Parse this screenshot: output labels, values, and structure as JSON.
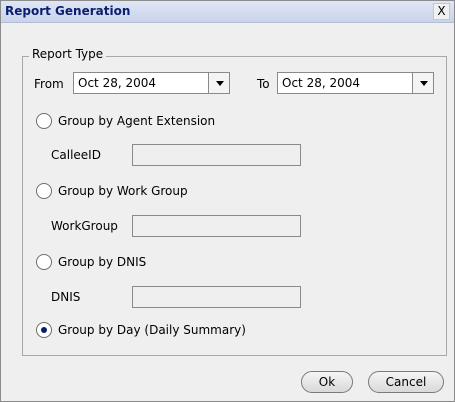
{
  "window": {
    "title": "Report Generation",
    "close_glyph": "X"
  },
  "report_type": {
    "legend": "Report Type",
    "from_label": "From",
    "from_value": "Oct 28, 2004",
    "to_label": "To",
    "to_value": "Oct 28, 2004"
  },
  "options": [
    {
      "label": "Group by Agent Extension",
      "selected": false
    },
    {
      "label": "Group by Work Group",
      "selected": false
    },
    {
      "label": "Group by DNIS",
      "selected": false
    },
    {
      "label": "Group by Day (Daily Summary)",
      "selected": true
    }
  ],
  "fields": [
    {
      "label": "CalleeID",
      "value": ""
    },
    {
      "label": "WorkGroup",
      "value": ""
    },
    {
      "label": "DNIS",
      "value": ""
    }
  ],
  "buttons": {
    "ok": "Ok",
    "cancel": "Cancel"
  }
}
